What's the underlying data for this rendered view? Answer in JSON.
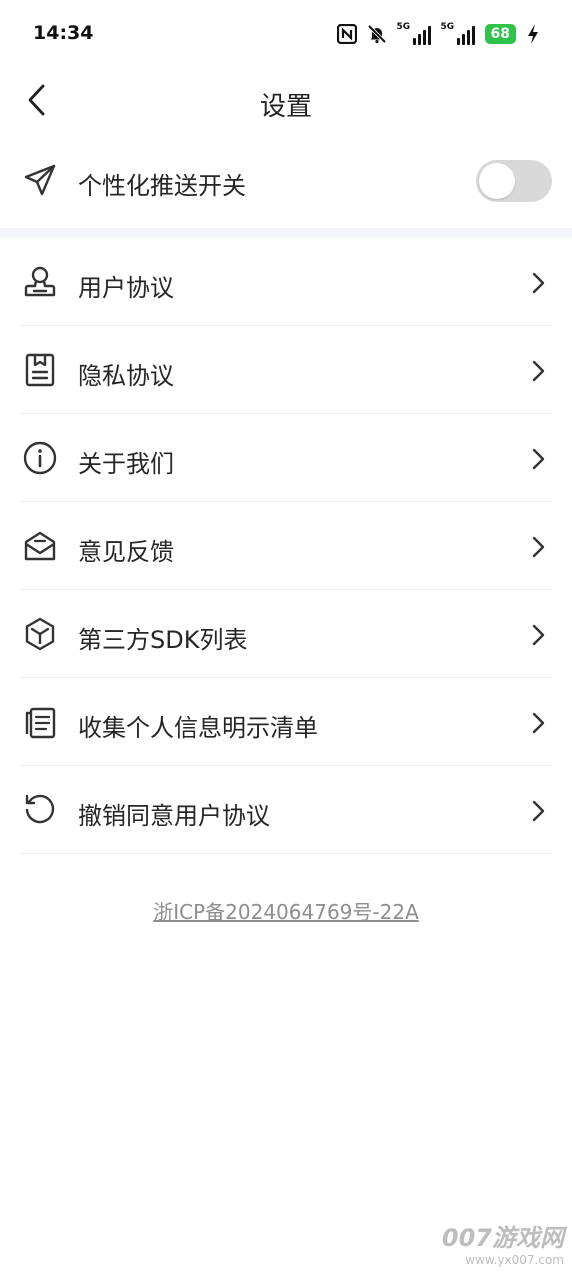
{
  "status_bar": {
    "time": "14:34",
    "signal1_tag": "5G",
    "signal2_tag": "5G",
    "battery": "68",
    "icons": [
      "nfc-icon",
      "mute-icon",
      "signal-icon",
      "signal-icon",
      "battery-icon",
      "charging-icon"
    ]
  },
  "header": {
    "title": "设置",
    "back_icon": "chevron-left-icon"
  },
  "push": {
    "label": "个性化推送开关",
    "icon": "paper-plane-icon",
    "enabled": false
  },
  "menu": [
    {
      "label": "用户协议",
      "icon": "user-agreement-icon"
    },
    {
      "label": "隐私协议",
      "icon": "privacy-document-icon"
    },
    {
      "label": "关于我们",
      "icon": "info-icon"
    },
    {
      "label": "意见反馈",
      "icon": "feedback-mail-icon"
    },
    {
      "label": "第三方SDK列表",
      "icon": "cube-icon"
    },
    {
      "label": "收集个人信息明示清单",
      "icon": "document-list-icon"
    },
    {
      "label": "撤销同意用户协议",
      "icon": "revoke-icon"
    }
  ],
  "footer": {
    "icp": "浙ICP备2024064769号-22A"
  },
  "watermark": {
    "brand": "007游戏网",
    "url": "www.yx007.com"
  },
  "colors": {
    "toggle_off": "#d9d9d9",
    "battery": "#2fc34a",
    "divider": "#f4f6fb",
    "icp_text": "#8e8e8e"
  }
}
